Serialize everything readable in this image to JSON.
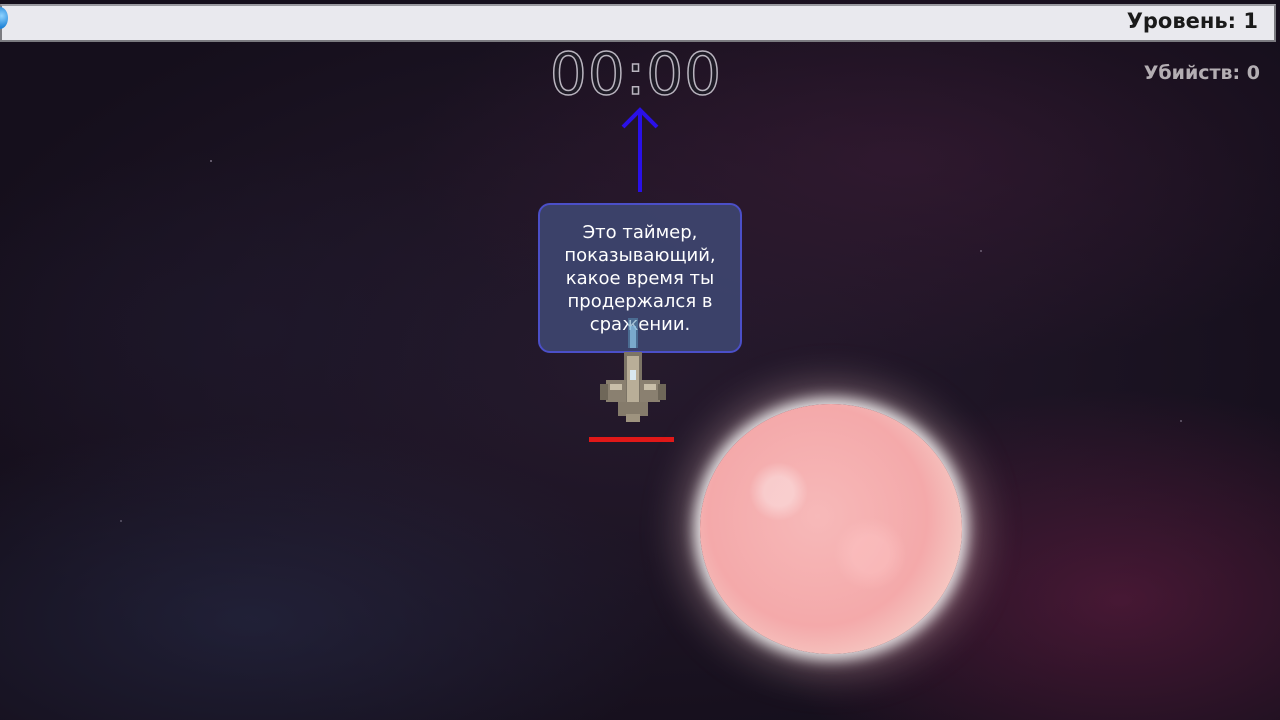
{
  "hud": {
    "level_label": "Уровень: 1",
    "level_progress": 0.0,
    "timer": "00:00",
    "kills_label": "Убийств: 0"
  },
  "tutorial": {
    "tooltip_text": "Это таймер, показывающий, какое время ты продержался в сражении."
  },
  "player": {
    "health_fraction": 1.0
  },
  "colors": {
    "tooltip_border": "#4b4fc8",
    "arrow": "#2a10e8",
    "health_bar": "#e01818",
    "xp_fill": "#2fa7ff"
  },
  "icons": {
    "player": "spaceship-icon",
    "arrow": "arrow-up-icon",
    "star": "star-sun-icon"
  }
}
